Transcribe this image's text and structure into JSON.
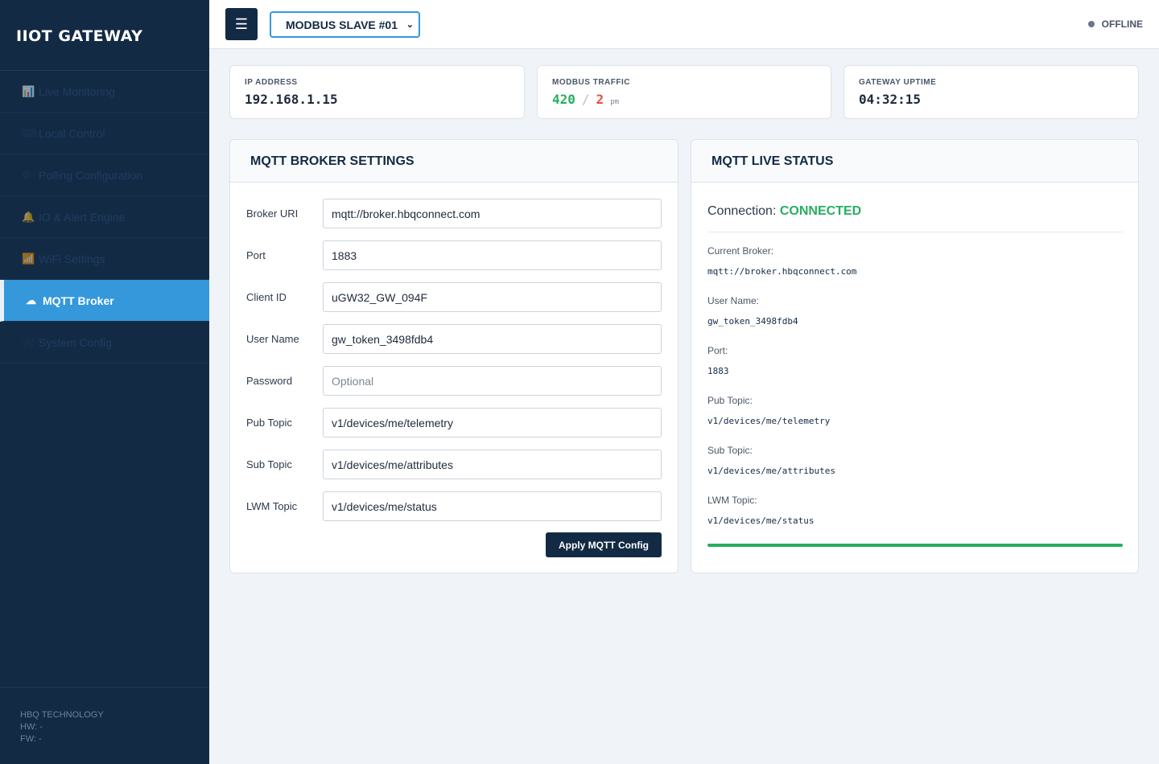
{
  "sidebar": {
    "brand": "IIOT GATEWAY",
    "items": [
      {
        "icon": "📊",
        "label": "Live Monitoring"
      },
      {
        "icon": "⌨",
        "label": "Local Control"
      },
      {
        "icon": "⚙",
        "label": "Polling Configuration"
      },
      {
        "icon": "🔔",
        "label": "IO & Alert Engine"
      },
      {
        "icon": "📶",
        "label": "WiFi Settings"
      },
      {
        "icon": "☁",
        "label": "MQTT Broker"
      },
      {
        "icon": "🛠",
        "label": "System Config"
      }
    ],
    "active_index": 5,
    "footer": {
      "company": "HBQ TECHNOLOGY",
      "hw": "HW: -",
      "fw": "FW: -"
    }
  },
  "topbar": {
    "menu_icon": "☰",
    "slave_selected": "MODBUS SLAVE #01",
    "status": "OFFLINE"
  },
  "stats": {
    "ip": {
      "label": "IP ADDRESS",
      "value": "192.168.1.15"
    },
    "traffic": {
      "label": "MODBUS TRAFFIC",
      "ok": "420",
      "sep": "/",
      "err": "2",
      "unit": "pm"
    },
    "uptime": {
      "label": "GATEWAY UPTIME",
      "value": "04:32:15"
    }
  },
  "broker_settings": {
    "title": "MQTT BROKER SETTINGS",
    "fields": [
      {
        "label": "Broker URI",
        "value": "mqtt://broker.hbqconnect.com",
        "placeholder": ""
      },
      {
        "label": "Port",
        "value": "1883",
        "placeholder": ""
      },
      {
        "label": "Client ID",
        "value": "uGW32_GW_094F",
        "placeholder": ""
      },
      {
        "label": "User Name",
        "value": "gw_token_3498fdb4",
        "placeholder": ""
      },
      {
        "label": "Password",
        "value": "",
        "placeholder": "Optional"
      },
      {
        "label": "Pub Topic",
        "value": "v1/devices/me/telemetry",
        "placeholder": ""
      },
      {
        "label": "Sub Topic",
        "value": "v1/devices/me/attributes",
        "placeholder": ""
      },
      {
        "label": "LWM Topic",
        "value": "v1/devices/me/status",
        "placeholder": ""
      }
    ],
    "apply_label": "Apply MQTT Config"
  },
  "live_status": {
    "title": "MQTT LIVE STATUS",
    "connection_label": "Connection:",
    "connection_value": "CONNECTED",
    "items": [
      {
        "key": "Current Broker:",
        "value": "mqtt://broker.hbqconnect.com"
      },
      {
        "key": "User Name:",
        "value": "gw_token_3498fdb4"
      },
      {
        "key": "Port:",
        "value": "1883"
      },
      {
        "key": "Pub Topic:",
        "value": "v1/devices/me/telemetry"
      },
      {
        "key": "Sub Topic:",
        "value": "v1/devices/me/attributes"
      },
      {
        "key": "LWM Topic:",
        "value": "v1/devices/me/status"
      }
    ]
  },
  "colors": {
    "sidebar_bg": "#132a45",
    "accent": "#3498db",
    "success": "#27ae60",
    "danger": "#e74c3c"
  }
}
